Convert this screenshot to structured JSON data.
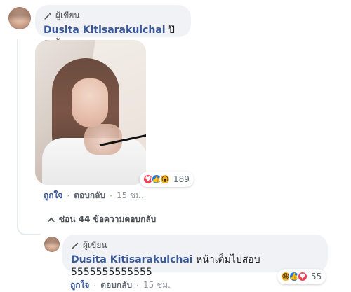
{
  "comment": {
    "badge_label": "ผู้เขียน",
    "author": "Dusita Kitisarakulchai",
    "text": "ป๊วะยัง",
    "reactions": {
      "types": [
        "love",
        "like",
        "wow"
      ],
      "count": "189"
    },
    "actions": {
      "like_label": "ถูกใจ",
      "reply_label": "ตอบกลับ",
      "separator": "·",
      "time": "15 ชม."
    }
  },
  "collapse": {
    "label": "ซ่อน 44 ข้อความตอบกลับ"
  },
  "reply": {
    "badge_label": "ผู้เขียน",
    "author": "Dusita Kitisarakulchai",
    "text": "หน้าเต็มไปสอบ",
    "text_line2": "5555555555555",
    "reactions": {
      "types": [
        "haha",
        "like",
        "love"
      ],
      "count": "55"
    },
    "actions": {
      "like_label": "ถูกใจ",
      "reply_label": "ตอบกลับ",
      "separator": "·",
      "time": "15 ชม."
    }
  },
  "colors": {
    "author_blue": "#385898",
    "bubble_bg": "#f0f2f5",
    "meta_gray": "#606770",
    "light_gray": "#90949c",
    "love": "#f33e58",
    "like": "#1877f2",
    "wow": "#f7b125"
  },
  "icons": {
    "author_badge": "pencil-icon",
    "collapse": "chevron-up-icon"
  }
}
